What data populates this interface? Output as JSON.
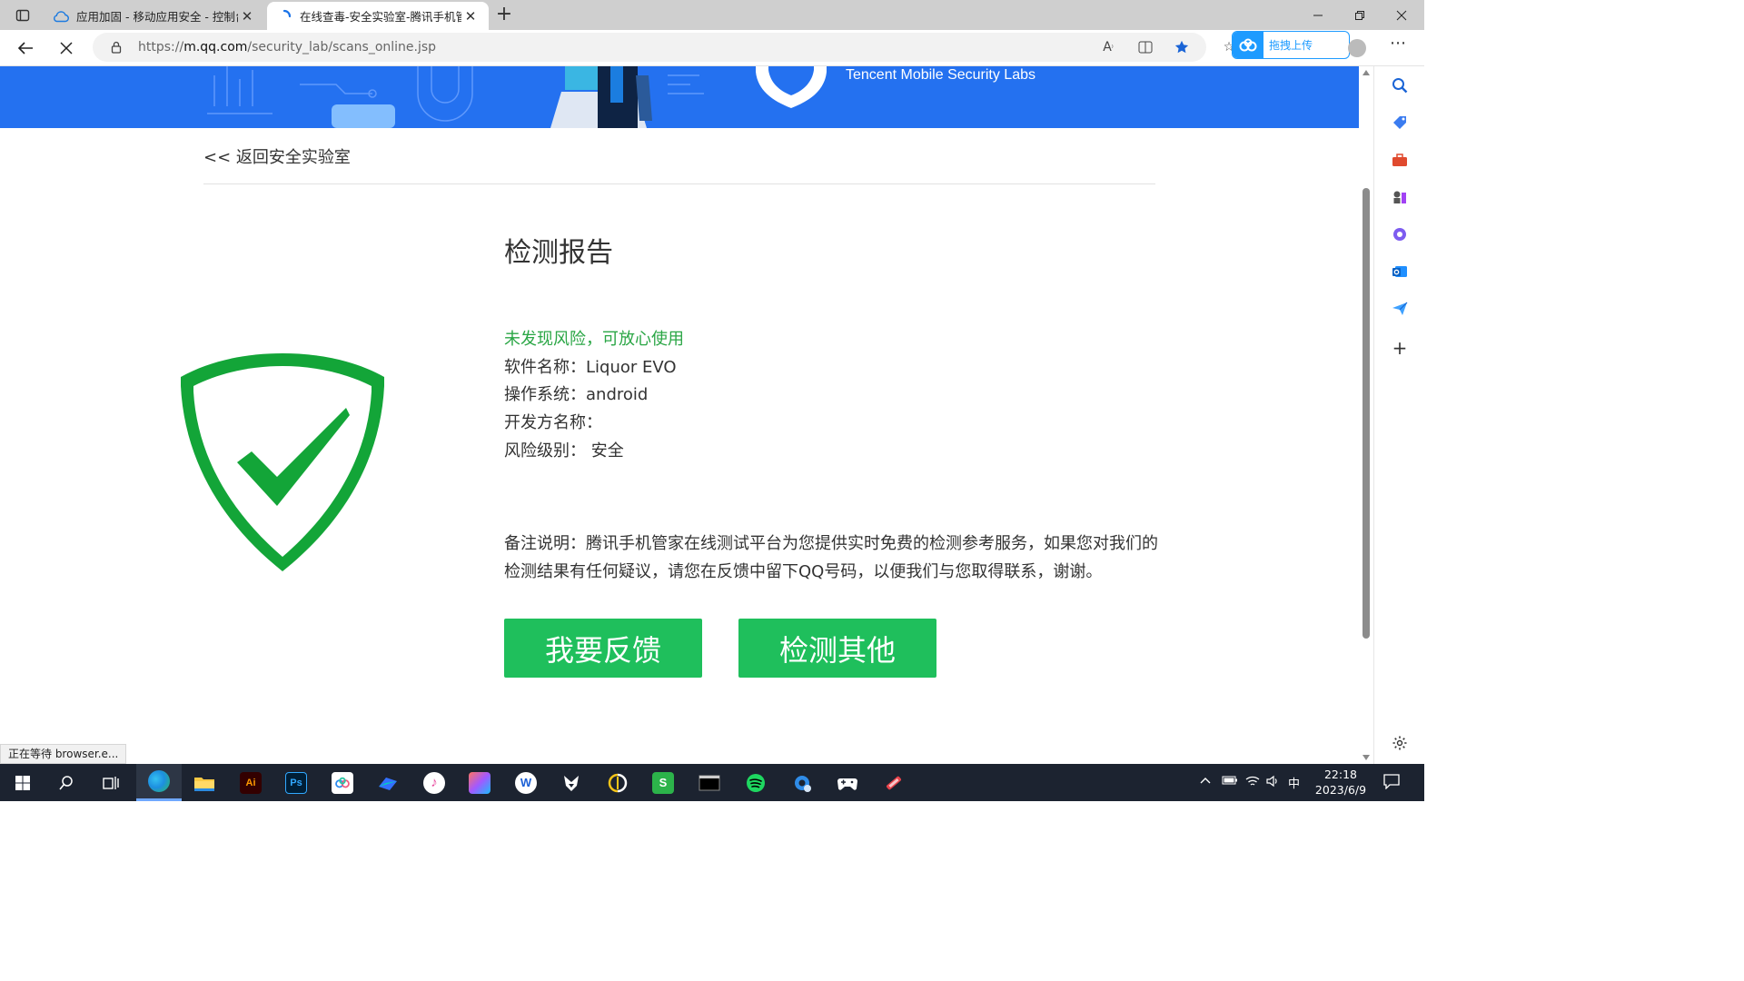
{
  "browser": {
    "tabs": [
      {
        "title": "应用加固 - 移动应用安全 - 控制台",
        "active": false
      },
      {
        "title": "在线查毒-安全实验室-腾讯手机管家",
        "active": true
      }
    ],
    "url_prefix": "https://",
    "url_host": "m.qq.com",
    "url_path": "/security_lab/scans_online.jsp",
    "upload_label": "拖拽上传",
    "status_text": "正在等待 browser.e..."
  },
  "hero": {
    "labs_text": "Tencent Mobile Security Labs"
  },
  "page": {
    "back_link": "<< 返回安全实验室",
    "report_title": "检测报告",
    "result": "未发现风险，可放心使用",
    "software_name": "软件名称：Liquor EVO",
    "os": "操作系统：android",
    "developer": "开发方名称：",
    "risk_level": "风险级别：  安全",
    "note": "备注说明：腾讯手机管家在线测试平台为您提供实时免费的检测参考服务，如果您对我们的检测结果有任何疑议，请您在反馈中留下QQ号码，以便我们与您取得联系，谢谢。",
    "feedback_button": "我要反馈",
    "check_other_button": "检测其他"
  },
  "taskbar": {
    "ime": "中",
    "time": "22:18",
    "date": "2023/6/9",
    "apps": [
      "start-icon",
      "search-icon",
      "task-view-icon",
      "edge-icon",
      "file-explorer-icon",
      "illustrator-icon",
      "photoshop-icon",
      "baidu-netdisk-icon",
      "feishu-icon",
      "itunes-icon",
      "figma-icon",
      "wps-icon",
      "fox-app-icon",
      "audio-app-icon",
      "spreadsheet-app-icon",
      "terminal-icon",
      "spotify-icon",
      "settings-app-icon",
      "game-controller-icon",
      "tool-app-icon"
    ]
  },
  "colors": {
    "brand_blue": "#2471f0",
    "safe_green": "#2aa645",
    "button_green": "#1fbf5c",
    "shield_green": "#13a538"
  }
}
